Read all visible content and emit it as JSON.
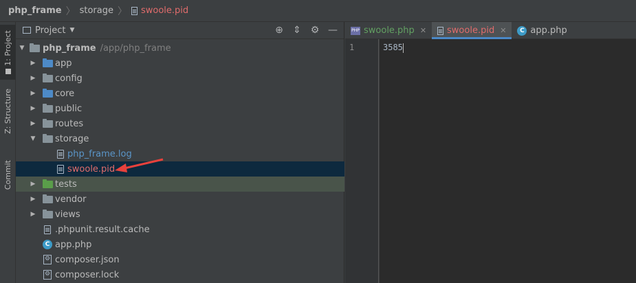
{
  "breadcrumb": {
    "project": "php_frame",
    "folder": "storage",
    "file": "swoole.pid"
  },
  "sidestrip": {
    "project_tab": "1: Project",
    "structure_tab": "Z: Structure",
    "commit_tab": "Commit"
  },
  "project_panel": {
    "title": "Project",
    "root_name": "php_frame",
    "root_path": "/app/php_frame",
    "items": [
      {
        "label": "app"
      },
      {
        "label": "config"
      },
      {
        "label": "core"
      },
      {
        "label": "public"
      },
      {
        "label": "routes"
      },
      {
        "label": "storage"
      },
      {
        "label": "php_frame.log"
      },
      {
        "label": "swoole.pid"
      },
      {
        "label": "tests"
      },
      {
        "label": "vendor"
      },
      {
        "label": "views"
      },
      {
        "label": ".phpunit.result.cache"
      },
      {
        "label": "app.php"
      },
      {
        "label": "composer.json"
      },
      {
        "label": "composer.lock"
      }
    ]
  },
  "editor": {
    "tabs": [
      {
        "label": "swoole.php",
        "color": "#62a062"
      },
      {
        "label": "swoole.pid",
        "color": "#e06c6c"
      },
      {
        "label": "app.php",
        "color": "#bbbbbb"
      }
    ],
    "line_number": "1",
    "content": "3585"
  },
  "colors": {
    "accent": "#4a88c7",
    "selection": "#0d293e",
    "annotation_arrow": "#e8413c"
  }
}
